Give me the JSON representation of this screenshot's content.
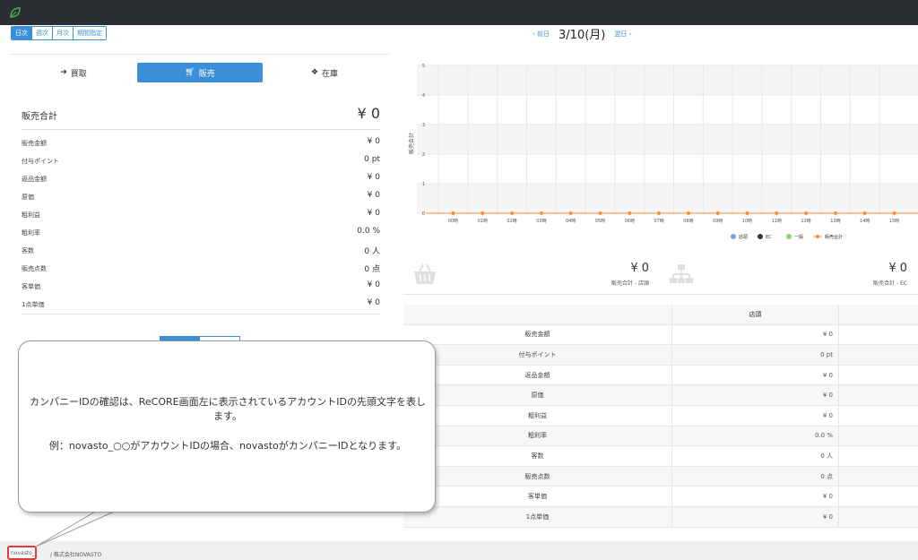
{
  "period_tabs": [
    "日次",
    "週次",
    "月次",
    "期間指定"
  ],
  "date_nav": {
    "prev": "‹ 前日",
    "date": "3/10(月)",
    "next": "翌日 ›"
  },
  "left_tabs": {
    "buy": "買取",
    "sell": "販売",
    "stock": "在庫"
  },
  "sales_total": {
    "label": "販売合計",
    "value": "¥ 0"
  },
  "metrics": [
    {
      "label": "販売金額",
      "value": "¥ 0"
    },
    {
      "label": "付与ポイント",
      "value": "0 pt"
    },
    {
      "label": "返品金額",
      "value": "¥ 0"
    },
    {
      "label": "原価",
      "value": "¥ 0"
    },
    {
      "label": "粗利益",
      "value": "¥ 0"
    },
    {
      "label": "粗利率",
      "value": "0.0 %"
    },
    {
      "label": "客数",
      "value": "0 人"
    },
    {
      "label": "販売点数",
      "value": "0 点"
    },
    {
      "label": "客単価",
      "value": "¥ 0"
    },
    {
      "label": "1点単価",
      "value": "¥ 0"
    }
  ],
  "chart_data": {
    "type": "line",
    "ylabel": "販売合計",
    "ylim": [
      0,
      5
    ],
    "yticks": [
      "0",
      "1",
      "2",
      "3",
      "4",
      "5"
    ],
    "categories": [
      "00時",
      "01時",
      "02時",
      "03時",
      "04時",
      "05時",
      "06時",
      "07時",
      "08時",
      "09時",
      "10時",
      "11時",
      "12時",
      "13時",
      "14時",
      "15時"
    ],
    "series": [
      {
        "name": "販売合計",
        "values": [
          0,
          0,
          0,
          0,
          0,
          0,
          0,
          0,
          0,
          0,
          0,
          0,
          0,
          0,
          0,
          0
        ]
      }
    ],
    "legend": [
      "店頭",
      "EC",
      "一般",
      "販売合計"
    ],
    "legend_colors": [
      "#6fa8dc",
      "#333333",
      "#93d36b",
      "#f0923a"
    ],
    "grid": true,
    "legend_position": "bottom"
  },
  "stats": [
    {
      "value": "¥ 0",
      "label": "販売合計 - 店頭"
    },
    {
      "value": "¥ 0",
      "label": "販売合計 - EC"
    }
  ],
  "table": {
    "header": "店頭",
    "rows": [
      {
        "label": "販売金額",
        "value": "¥ 0"
      },
      {
        "label": "付与ポイント",
        "value": "0 pt"
      },
      {
        "label": "返品金額",
        "value": "¥ 0"
      },
      {
        "label": "原価",
        "value": "¥ 0"
      },
      {
        "label": "粗利益",
        "value": "¥ 0"
      },
      {
        "label": "粗利率",
        "value": "0.0 %"
      },
      {
        "label": "客数",
        "value": "0 人"
      },
      {
        "label": "販売点数",
        "value": "0 点"
      },
      {
        "label": "客単価",
        "value": "¥ 0"
      },
      {
        "label": "1点単価",
        "value": "¥ 0"
      }
    ]
  },
  "footer": {
    "account": "novasto_",
    "company": "/ 株式会社NOVASTO"
  },
  "callout": {
    "line1": "カンパニーIDの確認は、ReCORE画面左に表示されているアカウントIDの先頭文字を表します。",
    "line2": "例：novasto_○○がアカウントIDの場合、novastoがカンパニーIDとなります。"
  },
  "colors": {
    "accent": "#3a8fd8",
    "topbar": "#2b2f33",
    "highlight": "#e53935"
  }
}
